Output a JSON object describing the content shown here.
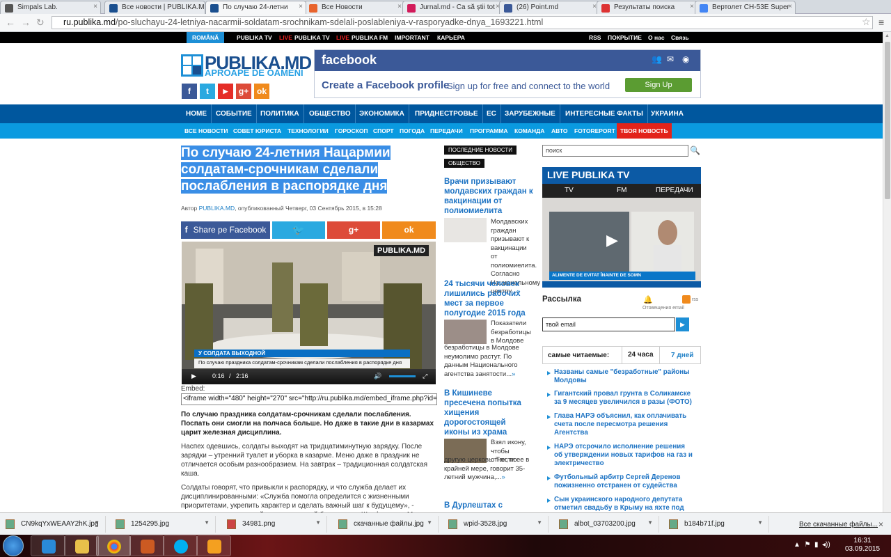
{
  "browser": {
    "tabs": [
      {
        "title": "Simpals Lab.",
        "color": "#555"
      },
      {
        "title": "Все новости | PUBLIKA.MD",
        "color": "#1a4f8f"
      },
      {
        "title": "По случаю 24-летни",
        "color": "#1a4f8f",
        "active": true
      },
      {
        "title": "Все Новости",
        "color": "#e8632c"
      },
      {
        "title": "Jurnal.md - Ca să știi tot",
        "color": "#d21a5a"
      },
      {
        "title": "(26) Point.md",
        "color": "#3b5998"
      },
      {
        "title": "Результаты поиска",
        "color": "#d33"
      },
      {
        "title": "Вертолет CH-53E Super",
        "color": "#4285f4"
      }
    ],
    "url_host": "ru.publika.md",
    "url_path": "/po-sluchayu-24-letniya-nacarmii-soldatam-srochnikam-sdelali-poslableniya-v-rasporyadke-dnya_1693221.html"
  },
  "topbar": {
    "romana": "ROMÂNĂ",
    "links": [
      "PUBLIKA TV",
      "LIVE",
      "PUBLIKA TV",
      "LIVE",
      "PUBLIKA FM",
      "IMPORTANT",
      "КАРЬЕРА"
    ],
    "right": [
      "RSS",
      "ПОКРЫТИЕ",
      "О нас",
      "Связь"
    ]
  },
  "logo": {
    "name": "PUBLIKA.MD",
    "tagline": "APROAPE DE OAMENI"
  },
  "social": [
    "f",
    "t",
    "▶",
    "g+",
    "ok"
  ],
  "fbad": {
    "brand": "facebook",
    "create": "Create a Facebook profile",
    "sub": "Sign up for free and connect to the world",
    "button": "Sign Up"
  },
  "mainnav": [
    "HOME",
    "СОБЫТИЕ",
    "ПОЛИТИКА",
    "ОБЩЕСТВО",
    "ЭКОНОМИКА",
    "ПРИДНЕСТРОВЬЕ",
    "ЕС",
    "ЗАРУБЕЖНЫЕ",
    "ИНТЕРЕСНЫЕ ФАКТЫ",
    "УКРАИНА"
  ],
  "subnav": [
    "ВСЕ НОВОСТИ",
    "СОВЕТ ЮРИСТА",
    "ТЕХНОЛОГИИ",
    "ГОРОСКОП",
    "СПОРТ",
    "ПОГОДА",
    "ПЕРЕДАЧИ",
    "ПРОГРАММА",
    "КОМАНДА",
    "АВТО",
    "FOTOREPORT",
    "ТВОЯ НОВОСТЬ"
  ],
  "article": {
    "title": "По случаю 24-летния Нацармии солдатам-срочникам сделали послабления в распорядке дня",
    "by_prefix": "Автор ",
    "author": "PUBLIKA.MD",
    "by_suffix": ", опубликованный Четверг, 03 Сентябрь 2015, в 15:28",
    "share_fb": "Share pe Facebook",
    "video_badge": "PUBLIKA.MD",
    "video_banner": "У СОЛДАТА ВЫХОДНОЙ",
    "video_sub": "По случаю праздника солдатам-срочникам",
    "video_sub2": "сделали послабления в распорядке дня",
    "time_cur": "0:16",
    "time_sep": "/",
    "time_total": "2:16",
    "embed_label": "Embed:",
    "embed_code": "<iframe width=\"480\" height=\"270\" src=\"http://ru.publika.md/embed_iframe.php?id=",
    "lead": "По случаю праздника солдатам-срочникам сделали послабления. Поспать они смогли на полчаса больше. Но даже в такие дни в казармах царит железная дисциплина.",
    "p1": "Наспех одевшись, солдаты выходят на тридцатиминутную зарядку. После зарядки – утренний туалет и уборка в казарме. Меню даже в праздник не отличается особым разнообразием. На завтрак – традиционная солдатская каша.",
    "p2": "Солдаты говорят, что привыкли к распорядку, и что служба делает их дисциплинированными: «Служба помогла определится с жизненными приоритетами, укрепить характер и сделать важный шаг к будущему», - считает военнослужащий мотострелковой бригады им. Штефана чел Маре."
  },
  "middle": {
    "tag1": "ПОСЛЕДНИЕ НОВОСТИ",
    "tag2": "ОБЩЕСТВО",
    "items": [
      {
        "head": "Врачи призывают молдавских граждан к вакцинации от полиомиелита",
        "text": "Молдавских граждан призывают к вакцинации от полиомиелита. Согласно Национальному центру...",
        "more": "»"
      },
      {
        "head": "24 тысячи человек лишились рабочих мест за первое полугодие 2015 года",
        "text": "Показатели безработицы в Молдове неумолимо растут.  По данным Национального агентства занятости...",
        "more": "»"
      },
      {
        "head": "В Кишиневе пресечена попытка хищения дорогостоящей иконы из храма",
        "text": "Взял икону, чтобы отнести ее в другую церковь. Так, по крайней мере, говорит 35-летний мужчина,...",
        "more": "»"
      },
      {
        "head": "В Дурлештах с",
        "text": "",
        "more": ""
      }
    ]
  },
  "right": {
    "search_placeholder": "поиск",
    "live_title": "LIVE PUBLIKA TV",
    "live_tabs": [
      "TV",
      "FM",
      "ПЕРЕДАЧИ"
    ],
    "live_ticker": "ALIMENTE DE EVITAT ÎNAINTE DE SOMN",
    "newsletter": "Рассылка",
    "notify": "Отовещения email",
    "rss": "rss",
    "email_placeholder": "твой email",
    "most_read": "самые читаемые:",
    "mr_tab1": "24 часа",
    "mr_tab2": "7 дней",
    "mr_items": [
      "Названы самые \"безработные\" районы Молдовы",
      "Гигантский провал грунта в Соликамске за 9 месяцев увеличился в разы (ФОТО)",
      "Глава НАРЭ объяснил, как оплачивать счета после пересмотра решения Агентства",
      "НАРЭ отсрочило исполнение решения об утверждении новых тарифов на газ и электричество",
      "Футбольный арбитр Сергей Деренов пожизненно отстранен от судейства",
      "Сын украинского народного депутата отметил свадьбу в Крыму на яхте под"
    ]
  },
  "downloads": {
    "items": [
      "CN9kqYxWEAAY2hK.jpg",
      "1254295.jpg",
      "34981.png",
      "скачанные файлы.jpg",
      "wpid-3528.jpg",
      "albot_03703200.jpg",
      "b184b71f.jpg"
    ],
    "all": "Все скачанные файлы..."
  },
  "taskbar": {
    "time": "16:31",
    "date": "03.09.2015"
  }
}
